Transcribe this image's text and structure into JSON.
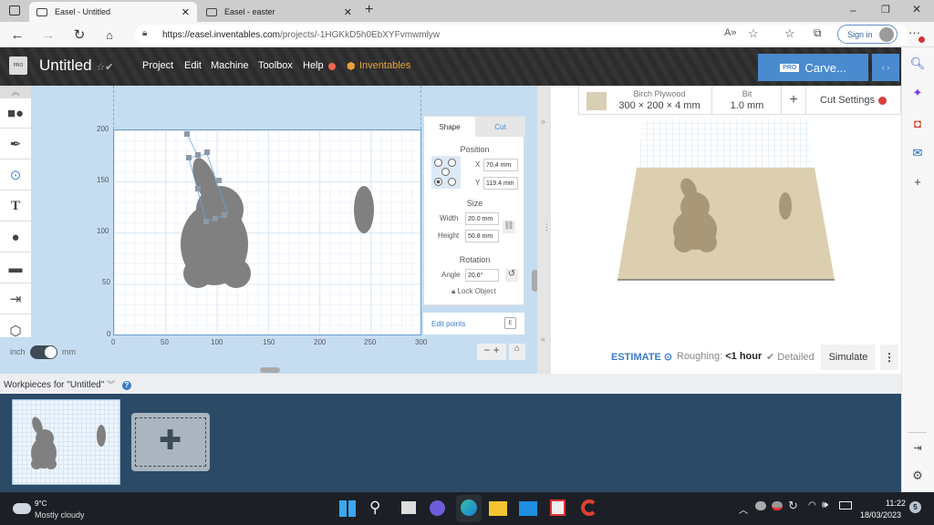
{
  "browser": {
    "tabs": [
      {
        "label": "Easel - Untitled",
        "active": true
      },
      {
        "label": "Easel - easter",
        "active": false
      }
    ],
    "url_host": "https://easel.inventables.com",
    "url_path": "/projects/-1HGKkD5h0EbXYFvmwmlyw",
    "signin_label": "Sign in"
  },
  "header": {
    "logo_text": "PRO",
    "project_title": "Untitled",
    "menu": [
      "Project",
      "Edit",
      "Machine",
      "Toolbox",
      "Help"
    ],
    "brand_link": "Inventables",
    "carve_pro_badge": "PRO",
    "carve_label": "Carve...",
    "accent_color": "#4a8bcf"
  },
  "canvas": {
    "y_ticks": [
      "200",
      "150",
      "100",
      "50",
      "0"
    ],
    "x_ticks": [
      "0",
      "50",
      "100",
      "150",
      "200",
      "250",
      "300"
    ],
    "unit_left": "inch",
    "unit_right": "mm",
    "unit_selected": "mm"
  },
  "shape_panel": {
    "tabs": [
      "Shape",
      "Cut"
    ],
    "active_tab": "Shape",
    "position_label": "Position",
    "x_label": "X",
    "x_value": "70.4 mm",
    "y_label": "Y",
    "y_value": "119.4 mm",
    "size_label": "Size",
    "width_label": "Width",
    "width_value": "20.0 mm",
    "height_label": "Height",
    "height_value": "50.8 mm",
    "rotation_label": "Rotation",
    "angle_label": "Angle",
    "angle_value": "20.6°",
    "lock_label": "Lock Object",
    "edit_points_label": "Edit points",
    "edit_points_key": "E"
  },
  "material": {
    "name": "Birch Plywood",
    "dims": "300 × 200 × 4 mm",
    "bit_label": "Bit",
    "bit_value": "1.0 mm",
    "add_label": "+",
    "cut_settings_label": "Cut Settings"
  },
  "estimate": {
    "label": "ESTIMATE",
    "roughing_label": "Roughing:",
    "roughing_value": "<1 hour",
    "detailed_label": "Detailed",
    "simulate_label": "Simulate"
  },
  "workpieces": {
    "header": "Workpieces for \"Untitled\""
  },
  "taskbar": {
    "temp": "9°C",
    "weather": "Mostly cloudy",
    "time": "11:22",
    "date": "18/03/2023",
    "notifications": "5"
  }
}
